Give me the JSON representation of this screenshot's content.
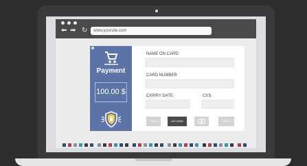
{
  "browser": {
    "url": "www.yoursite.com"
  },
  "payment_panel": {
    "title": "Payment",
    "amount": "100.00 $"
  },
  "form": {
    "name_label": "NAME ON CARD",
    "number_label": "CARD NUMBER",
    "expiry_label": "EXPIRY DATE",
    "cvs_label": "CVS"
  },
  "card_logos": [
    {
      "label": "VISA",
      "icon": "visa-logo",
      "color": "#d4d4d6"
    },
    {
      "label": "MYCARD",
      "icon": "mycard-logo",
      "color": "#4b4b4e"
    },
    {
      "label": "",
      "icon": "mastercard-logo",
      "color": "#d4d4d6"
    },
    {
      "label": "PayPal",
      "icon": "paypal-logo",
      "color": "#d4d4d6"
    }
  ],
  "thumbnail_colors": [
    "#2d4a7a",
    "#c23a4a",
    "#8a8fa0",
    "#2c9ab0",
    "#3c3c3e",
    "#2d4a7a",
    "#8a8fa0",
    "#3c3c3e",
    "#c23a4a",
    "#2c9ab0",
    "#2d4a7a",
    "#3c3c3e",
    "#2d4a7a",
    "#c23a4a",
    "#8a8fa0",
    "#2c9ab0",
    "#3c3c3e",
    "#2d4a7a",
    "#8a8fa0",
    "#3c3c3e",
    "#2c9ab0",
    "#c23a4a",
    "#2d4a7a",
    "#2c9ab0",
    "#3c3c3e",
    "#c23a4a",
    "#2d4a7a",
    "#8a8fa0",
    "#2c9ab0",
    "#3c3c3e",
    "#c23a4a",
    "#2d4a7a"
  ],
  "colors": {
    "panel_blue": "#5d74a8",
    "bezel": "#3a3a3d"
  }
}
